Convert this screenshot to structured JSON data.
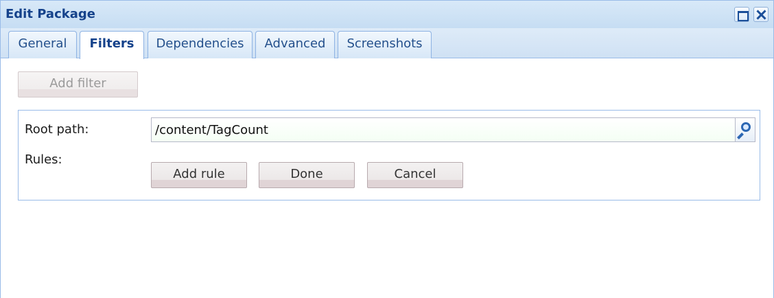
{
  "window": {
    "title": "Edit Package"
  },
  "tabs": [
    {
      "label": "General"
    },
    {
      "label": "Filters"
    },
    {
      "label": "Dependencies"
    },
    {
      "label": "Advanced"
    },
    {
      "label": "Screenshots"
    }
  ],
  "active_tab": "Filters",
  "filters": {
    "add_filter_label": "Add filter",
    "root_path_label": "Root path:",
    "root_path_value": "/content/TagCount",
    "rules_label": "Rules:",
    "add_rule_label": "Add rule",
    "done_label": "Done",
    "cancel_label": "Cancel"
  },
  "icons": {
    "maximize": "maximize-icon",
    "close": "close-icon",
    "browse": "search-icon"
  },
  "colors": {
    "title": "#15428b",
    "border": "#99bbe8"
  }
}
